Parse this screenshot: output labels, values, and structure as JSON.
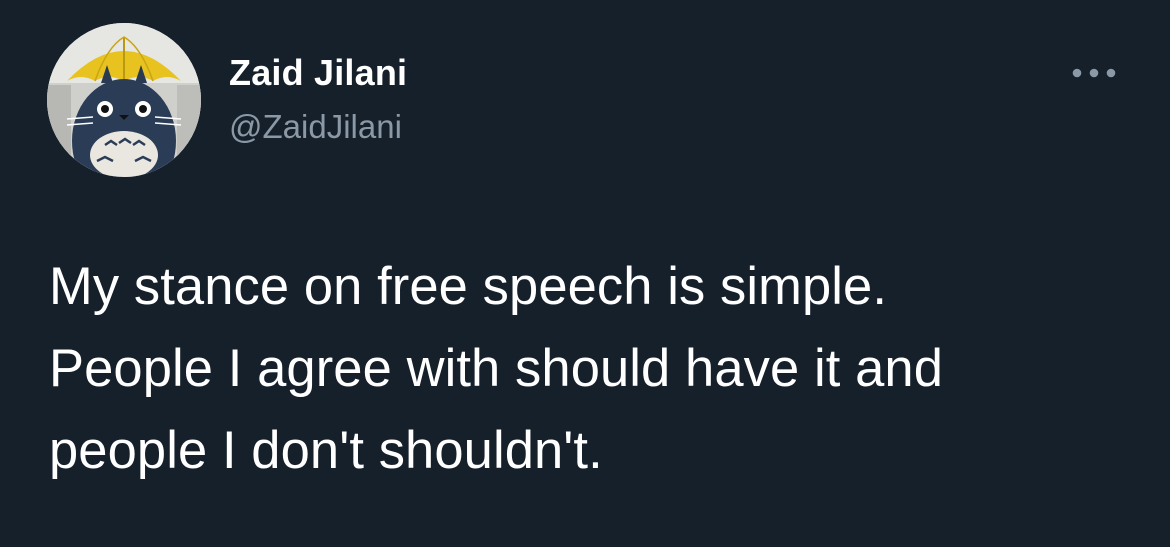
{
  "tweet": {
    "author_name": "Zaid Jilani",
    "author_handle": "@ZaidJilani",
    "text_lines": [
      "My stance on free speech is simple.",
      "People I agree with should have it and",
      "people I don't shouldn't."
    ],
    "avatar_icon": "avatar-umbrella-totoro-icon",
    "more_icon": "more-horizontal-icon"
  },
  "colors": {
    "background": "#15202b",
    "primary_text": "#ffffff",
    "secondary_text": "#8b98a5",
    "umbrella_yellow": "#e8c21f"
  }
}
